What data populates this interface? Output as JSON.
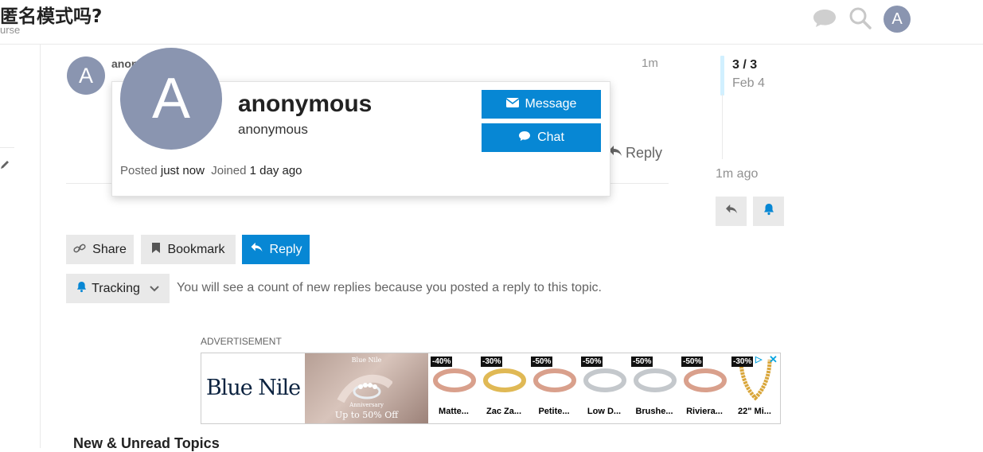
{
  "header": {
    "title": "匿名模式吗?",
    "subtitle": "urse",
    "user_initial": "A"
  },
  "post": {
    "username": "anon",
    "avatar_initial": "A",
    "age": "1m",
    "reply_label": "Reply"
  },
  "user_card": {
    "avatar_initial": "A",
    "display_name": "anonymous",
    "username": "anonymous",
    "message_label": "Message",
    "chat_label": "Chat",
    "posted_label": "Posted",
    "posted_value": "just now",
    "joined_label": "Joined",
    "joined_value": "1 day ago"
  },
  "timeline": {
    "position": "3 / 3",
    "date": "Feb 4",
    "last_activity": "1m ago"
  },
  "actions": {
    "share_label": "Share",
    "bookmark_label": "Bookmark",
    "reply_label": "Reply"
  },
  "tracking": {
    "label": "Tracking",
    "description": "You will see a count of new replies because you posted a reply to this topic."
  },
  "ad": {
    "label": "ADVERTISEMENT",
    "brand": "Blue Nile",
    "banner_small_brand": "Blue Nile",
    "banner_subtext": "Anniversary",
    "banner_offer": "Up to 50% Off",
    "products": [
      {
        "discount": "-40%",
        "name": "Matte...",
        "metal": "rose"
      },
      {
        "discount": "-30%",
        "name": "Zac Za...",
        "metal": "gold"
      },
      {
        "discount": "-50%",
        "name": "Petite...",
        "metal": "rose"
      },
      {
        "discount": "-50%",
        "name": "Low D...",
        "metal": "silver"
      },
      {
        "discount": "-50%",
        "name": "Brushe...",
        "metal": "silver"
      },
      {
        "discount": "-50%",
        "name": "Riviera...",
        "metal": "rose"
      },
      {
        "discount": "-30%",
        "name": "22\" Mi...",
        "metal": "chain"
      }
    ]
  },
  "section": {
    "heading": "New & Unread Topics"
  },
  "colors": {
    "primary": "#0787d4",
    "avatar": "#8a95b0",
    "timeline_highlight": "#d1f0ff"
  }
}
